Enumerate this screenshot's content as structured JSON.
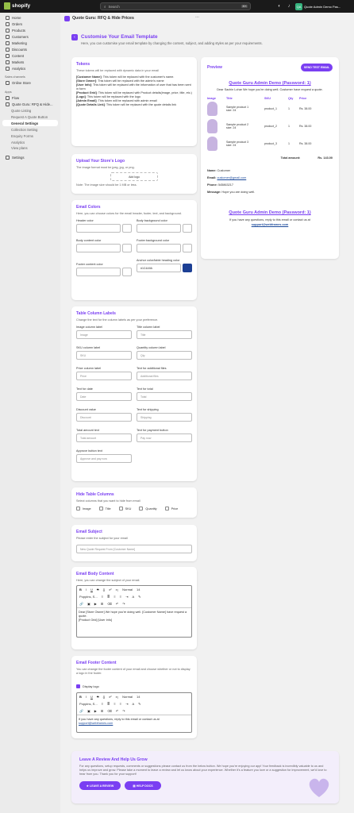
{
  "topbar": {
    "brand": "shopify",
    "search_placeholder": "Search",
    "shortcut": "⌘K",
    "store_initials": "QA",
    "store_name": "Quote Admin Demo Pas..."
  },
  "sidebar": {
    "items": [
      "Home",
      "Orders",
      "Products",
      "Customers",
      "Marketing",
      "Discounts",
      "Content",
      "Markets",
      "Analytics"
    ],
    "sales_head": "Sales channels",
    "sales": [
      "Online Store"
    ],
    "apps_head": "Apps",
    "apps": [
      "Flow",
      "Quote Guru: RFQ & Hide..."
    ],
    "app_sub": [
      "Quote Listing",
      "Request A Quote Button",
      "General Settings",
      "Collection Setting",
      "Enquiry Forms",
      "Analytics",
      "View plans"
    ],
    "settings": "Settings"
  },
  "app": {
    "name": "Quote Guru: RFQ & Hide Prices"
  },
  "page": {
    "title": "Customise Your Email Template",
    "subtitle": "Here, you can customise your email template by changing the content, subject, and adding styles as per your requirements."
  },
  "tokens": {
    "title": "Tokens",
    "subtitle": "These tokens will be replaced with dynamic data in your email",
    "items": [
      [
        "[Customer Name]",
        ": This token will be replaced with the customer's name."
      ],
      [
        "[Store Owner]",
        ": This token will be replaced with the admin's name"
      ],
      [
        "[User Info]",
        ": This token will be replaced with the information of user that has been sent in form"
      ],
      [
        "[Product Grid]",
        ": This token will be replaced with Product details(image, price, title, etc.)"
      ],
      [
        "[Logo]",
        ": This token will be replaced with the logo"
      ],
      [
        "[Admin Email]",
        ": This token will be replaced with admin email"
      ],
      [
        "[Quote Details Link]",
        ": This token will be replaced with the quote details link"
      ]
    ]
  },
  "logo": {
    "title": "Upload Your Store's Logo",
    "subtitle": "The image format must be jpeg, jpg, or png.",
    "button": "Add logo",
    "note": "Note: The image size should be 1 MB or less."
  },
  "colors": {
    "title": "Email Colors",
    "subtitle": "Here, you can choose colors for the email header, footer, text, and background.",
    "header": "Header color",
    "body_bg": "Body background color",
    "body_content": "Body content color",
    "footer_bg": "Footer background color",
    "footer_content": "Footer content color",
    "anchor": "Anchor color/table heading color",
    "anchor_value": "#1C4A9A",
    "anchor_swatch": "#1c3f94"
  },
  "columns": {
    "title": "Table Column Labels",
    "subtitle": "Change the text for the column labels as per your preference.",
    "fields": [
      [
        "Image column label",
        "Image"
      ],
      [
        "Title column label",
        "Title"
      ],
      [
        "SKU column label",
        "SKU"
      ],
      [
        "Quantity column label",
        "Qty"
      ],
      [
        "Price column label",
        "Price"
      ],
      [
        "Text for additional files",
        "Additional files"
      ],
      [
        "Text for date",
        "Date"
      ],
      [
        "Text for total",
        "Total"
      ],
      [
        "Discount value",
        "Discount"
      ],
      [
        "Text for shipping",
        "Shipping"
      ],
      [
        "Total amount text",
        "Total amount"
      ],
      [
        "Text for payment button",
        "Pay now"
      ],
      [
        "Approve button text",
        "Approve and pay now"
      ]
    ]
  },
  "hide": {
    "title": "Hide Table Columns",
    "subtitle": "Select columns that you want to hide from email",
    "options": [
      "Image",
      "Title",
      "SKU",
      "Quantity",
      "Price"
    ]
  },
  "subject": {
    "title": "Email Subject",
    "subtitle": "Please enter the subject for your email",
    "value": "New Quote Request From [Customer Name]"
  },
  "body": {
    "title": "Email Body Content",
    "subtitle": "Here, you can change the subject of your email.",
    "style": "Normal",
    "size": "14",
    "font": "Poppins, S...",
    "lines": [
      "Dear [Store Owner] We hope you're doing well. [Customer Name] have request a quote.",
      "[Product Grid] [User Info]"
    ]
  },
  "footer": {
    "title": "Email Footer Content",
    "subtitle": "You can change the footer content of your email and choose whether or not to display a logo in the footer.",
    "display_logo": "Display logo",
    "text": "If you have any questions, reply to this email or contact us at",
    "link": "support@webframes.com"
  },
  "preview": {
    "heading": "Preview",
    "send_btn": "SEND TEST EMAIL",
    "store": "Quote Guru Admin Demo (Password: 1)",
    "greeting": "Dear Sachin Lohar We hope you're doing well. Customer have request a quote.",
    "head": [
      "Image",
      "Title",
      "SKU",
      "Qty",
      "Price"
    ],
    "rows": [
      [
        "Sample product 1",
        "size: 24",
        "product_1",
        "1",
        "Rs. 38.00"
      ],
      [
        "Sample product 2",
        "size: 24",
        "product_2",
        "1",
        "Rs. 38.00"
      ],
      [
        "Sample product 3",
        "size: 24",
        "product_3",
        "1",
        "Rs. 38.00"
      ]
    ],
    "total_label": "Total amount:",
    "total": "Rs. 143.00",
    "name_l": "Name:",
    "name": "Customer",
    "email_l": "Email:",
    "email": "customer@gmail.com",
    "phone_l": "Phone:",
    "phone": "545863217",
    "msg_l": "Message:",
    "msg": "Hope you are doing well.",
    "footer_store": "Quote Guru Admin Demo (Password: 1)",
    "footer_text": "If you have any questions, reply to this email or contact us at",
    "footer_link": "support@webframes.com"
  },
  "review": {
    "title": "Leave A Review And Help Us Grow",
    "text": "For any questions, setup requests, comments or suggestions please contact us from the below button. We hope you're enjoying our app! Your feedback is incredibly valuable to us and helps us improve and grow. Please take a moment to leave a review and let us know about your experience. Whether it's a feature you love or a suggestion for improvement, we'd love to hear from you. Thank you for your support!",
    "btn1": "LEAVE A REVIEW",
    "btn2": "HELP DOCS"
  }
}
